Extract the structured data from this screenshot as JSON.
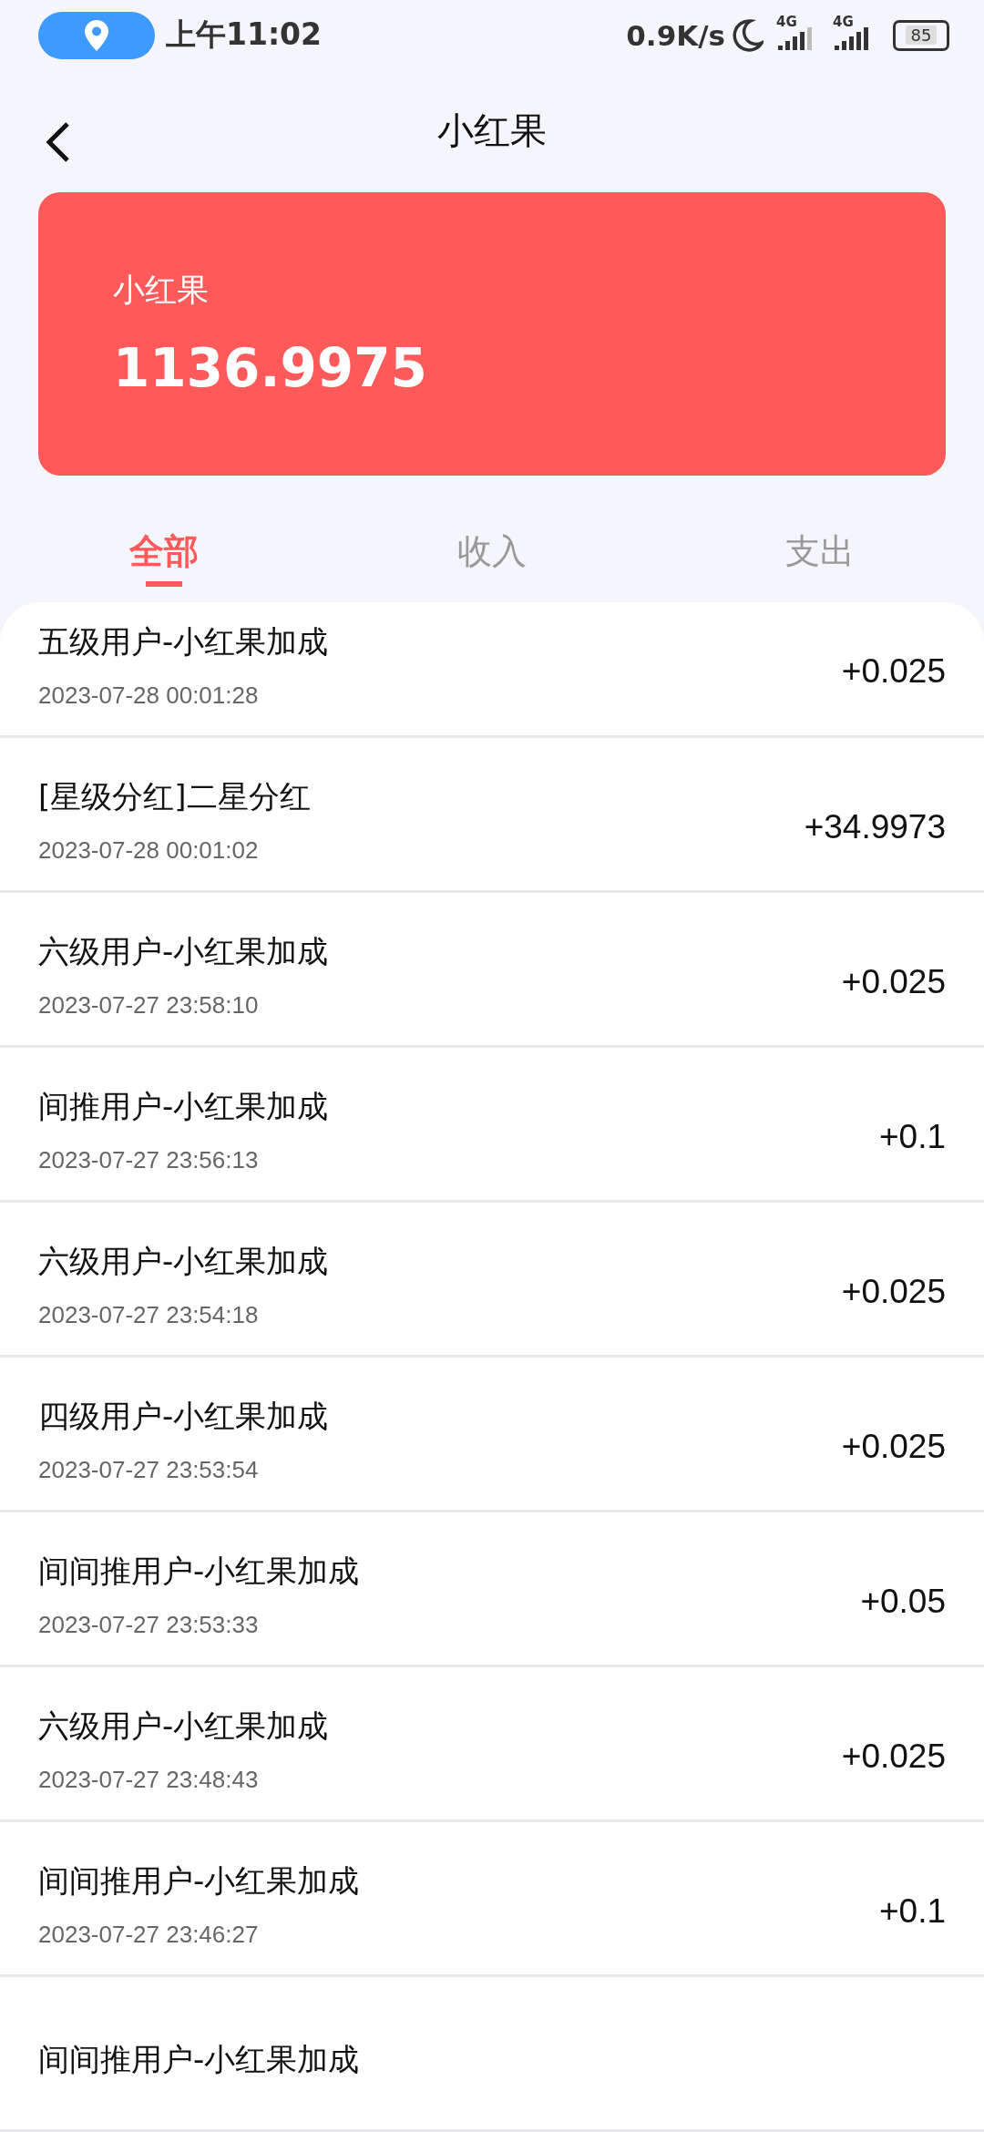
{
  "status_bar": {
    "time": "上午11:02",
    "speed": "0.9K/s",
    "signals": [
      {
        "label": "4G",
        "level": 0.8
      },
      {
        "label": "4G",
        "level": 1
      }
    ],
    "battery": "85"
  },
  "header": {
    "title": "小红果"
  },
  "balance_card": {
    "label": "小红果",
    "value": "1136.9975"
  },
  "tabs": [
    {
      "label": "全部",
      "selected": true
    },
    {
      "label": "收入",
      "selected": false
    },
    {
      "label": "支出",
      "selected": false
    }
  ],
  "records": [
    {
      "title": "五级用户-小红果加成",
      "time": "2023-07-28 00:01:28",
      "amount": "+0.025"
    },
    {
      "title": "[星级分红]二星分红",
      "time": "2023-07-28 00:01:02",
      "amount": "+34.9973"
    },
    {
      "title": "六级用户-小红果加成",
      "time": "2023-07-27 23:58:10",
      "amount": "+0.025"
    },
    {
      "title": "间推用户-小红果加成",
      "time": "2023-07-27 23:56:13",
      "amount": "+0.1"
    },
    {
      "title": "六级用户-小红果加成",
      "time": "2023-07-27 23:54:18",
      "amount": "+0.025"
    },
    {
      "title": "四级用户-小红果加成",
      "time": "2023-07-27 23:53:54",
      "amount": "+0.025"
    },
    {
      "title": "间间推用户-小红果加成",
      "time": "2023-07-27 23:53:33",
      "amount": "+0.05"
    },
    {
      "title": "六级用户-小红果加成",
      "time": "2023-07-27 23:48:43",
      "amount": "+0.025"
    },
    {
      "title": "间间推用户-小红果加成",
      "time": "2023-07-27 23:46:27",
      "amount": "+0.1"
    },
    {
      "title": "间间推用户-小红果加成"
    }
  ]
}
